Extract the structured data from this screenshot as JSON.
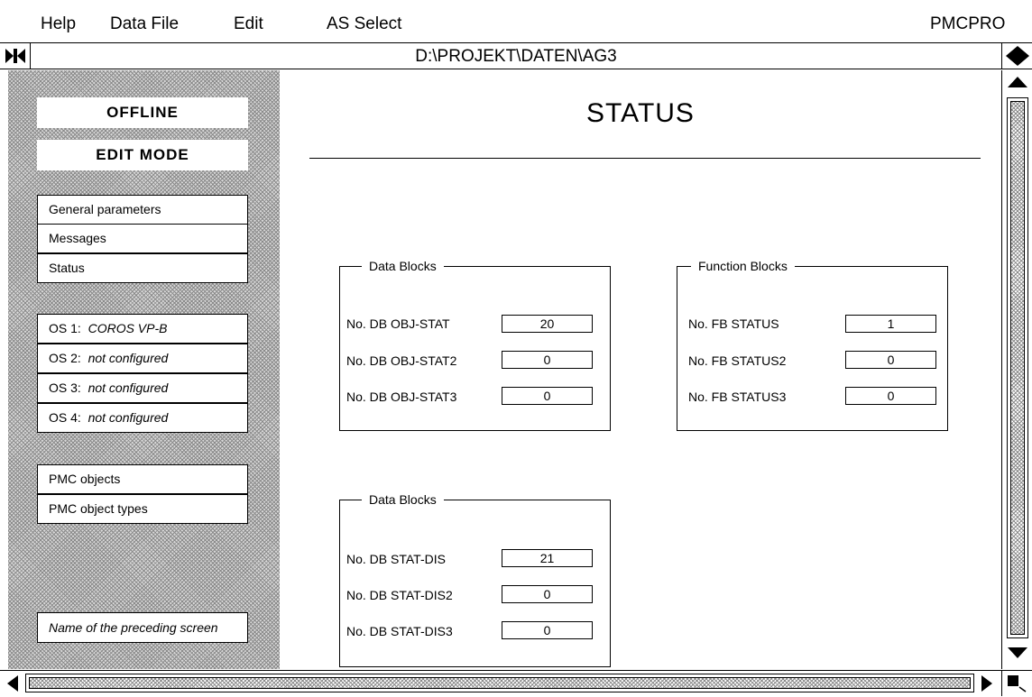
{
  "menu": {
    "items": [
      "Help",
      "Data File",
      "Edit",
      "AS Select"
    ],
    "app_name": "PMCPRO"
  },
  "titlebar": {
    "path": "D:\\PROJEKT\\DATEN\\AG3"
  },
  "sidebar": {
    "mode_offline": "OFFLINE",
    "mode_edit": "EDIT MODE",
    "nav_items": [
      "General parameters",
      "Messages",
      "Status"
    ],
    "os_items": [
      {
        "label": "OS 1:",
        "name": "COROS VP-B"
      },
      {
        "label": "OS 2:",
        "name": "not configured"
      },
      {
        "label": "OS 3:",
        "name": "not configured"
      },
      {
        "label": "OS 4:",
        "name": "not configured"
      }
    ],
    "object_items": [
      "PMC objects",
      "PMC object types"
    ],
    "preceding_screen": "Name of the preceding screen"
  },
  "main": {
    "title": "STATUS",
    "groups": [
      {
        "legend": "Data Blocks",
        "fields": [
          {
            "label": "No. DB OBJ-STAT",
            "value": "20"
          },
          {
            "label": "No. DB OBJ-STAT2",
            "value": "0"
          },
          {
            "label": "No. DB OBJ-STAT3",
            "value": "0"
          }
        ]
      },
      {
        "legend": "Function  Blocks",
        "fields": [
          {
            "label": "No. FB STATUS",
            "value": "1"
          },
          {
            "label": "No. FB STATUS2",
            "value": "0"
          },
          {
            "label": "No. FB STATUS3",
            "value": "0"
          }
        ]
      },
      {
        "legend": "Data Blocks",
        "fields": [
          {
            "label": "No. DB STAT-DIS",
            "value": "21"
          },
          {
            "label": "No. DB STAT-DIS2",
            "value": "0"
          },
          {
            "label": "No. DB STAT-DIS3",
            "value": "0"
          }
        ]
      }
    ]
  },
  "icons": {
    "titlebar_left": "bowtie-icon",
    "titlebar_right": "diamond-icon",
    "scroll_up": "triangle-up-icon",
    "scroll_down": "triangle-down-icon",
    "scroll_left": "triangle-left-icon",
    "scroll_right": "triangle-right-icon",
    "resize": "resize-corner-icon"
  }
}
